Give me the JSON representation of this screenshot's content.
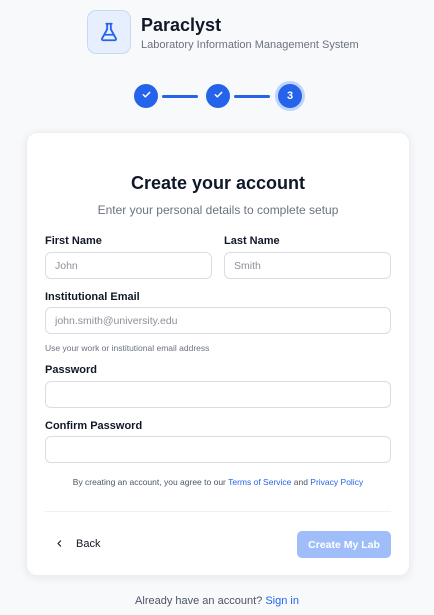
{
  "brand": {
    "name": "Paraclyst",
    "subtitle": "Laboratory Information Management System",
    "logo_icon": "flask-icon"
  },
  "stepper": {
    "steps": [
      {
        "state": "complete",
        "icon": "check-icon"
      },
      {
        "state": "complete",
        "icon": "check-icon"
      },
      {
        "state": "current",
        "label": "3"
      }
    ],
    "accent": "#2563eb"
  },
  "card": {
    "title": "Create your account",
    "subtitle": "Enter your personal details to complete setup"
  },
  "form": {
    "first_name": {
      "label": "First Name",
      "placeholder": "John",
      "value": ""
    },
    "last_name": {
      "label": "Last Name",
      "placeholder": "Smith",
      "value": ""
    },
    "email": {
      "label": "Institutional Email",
      "placeholder": "john.smith@university.edu",
      "value": "",
      "hint": "Use your work or institutional email address"
    },
    "password": {
      "label": "Password",
      "placeholder": "",
      "value": ""
    },
    "confirm_password": {
      "label": "Confirm Password",
      "placeholder": "",
      "value": ""
    }
  },
  "terms": {
    "prefix": "By creating an account, you agree to our ",
    "terms_link": "Terms of Service",
    "and": " and ",
    "privacy_link": "Privacy Policy"
  },
  "actions": {
    "back_label": "Back",
    "create_label": "Create My Lab",
    "create_color": "#9fbdf8"
  },
  "footer": {
    "prompt": "Already have an account? ",
    "signin_link": "Sign in"
  }
}
